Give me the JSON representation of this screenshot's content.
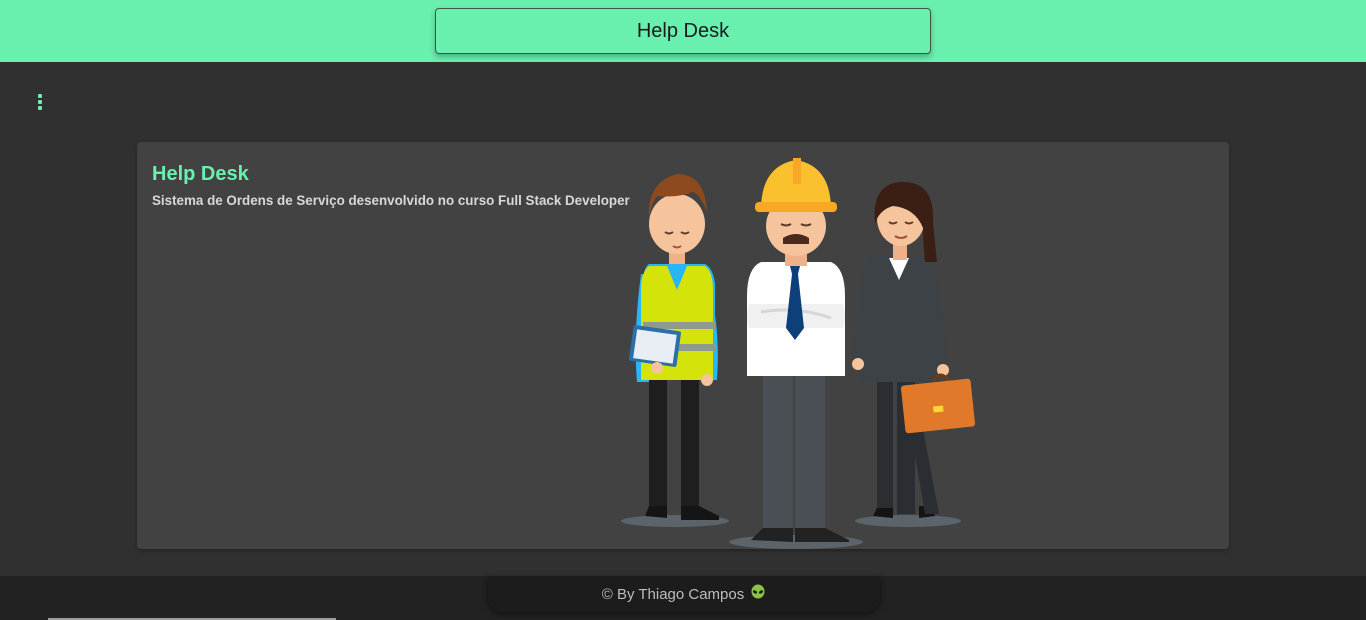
{
  "header": {
    "title": "Help Desk"
  },
  "menu": {
    "icon": "more-vert-icon"
  },
  "card": {
    "title": "Help Desk",
    "subtitle": "Sistema de Ordens de Serviço desenvolvido no curso Full Stack Developer",
    "illustration": "three-workers-illustration"
  },
  "footer": {
    "credit": "© By Thiago Campos",
    "icon": "alien-icon"
  },
  "colors": {
    "accent": "#69f0ae",
    "background": "#303030",
    "card": "#424242",
    "footer": "#222222"
  }
}
